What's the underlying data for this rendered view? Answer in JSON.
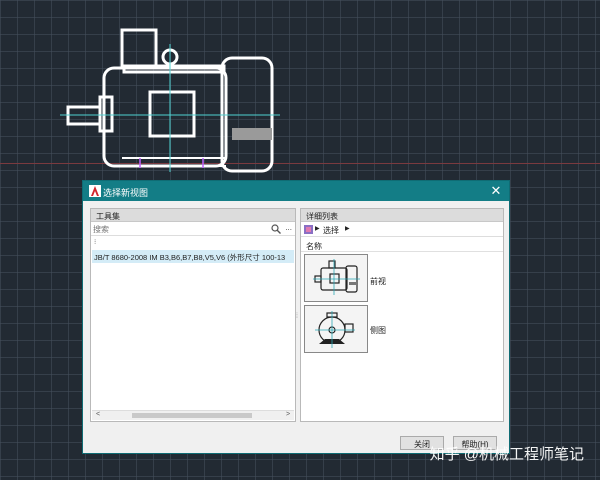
{
  "dialog": {
    "title": "选择新视图",
    "close_glyph": "✕",
    "left_panel": {
      "header": "工具集",
      "search_placeholder": "搜索",
      "more": "...",
      "tree_root": "⁝",
      "selected_item": "JB/T 8680-2008 IM B3,B6,B7,B8,V5,V6 (外形尺寸 100-13",
      "scroll_left": "<",
      "scroll_right": ">"
    },
    "right_panel": {
      "header": "详细列表",
      "crumb_label": "选择",
      "column_name": "名称",
      "views": [
        {
          "label": "前视",
          "icon": "motor-front-icon"
        },
        {
          "label": "侧图",
          "icon": "motor-side-icon"
        }
      ]
    },
    "buttons": {
      "close": "关闭",
      "help": "帮助(H)"
    }
  },
  "watermark": "知乎 @机械工程师笔记",
  "colors": {
    "titlebar": "#137d86",
    "selection": "#d4ecf7",
    "cad_background": "#222a33",
    "cad_line": "#ffffff",
    "center_line": "#4fd2d2"
  }
}
